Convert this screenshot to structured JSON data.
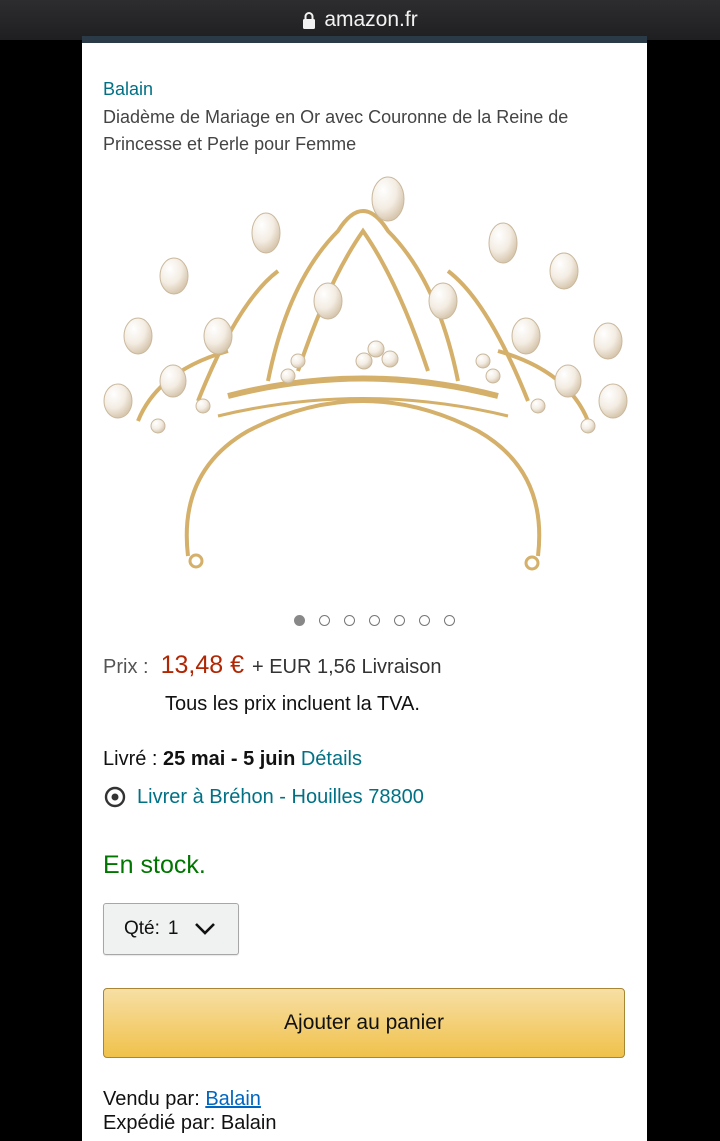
{
  "browser": {
    "url": "amazon.fr"
  },
  "product": {
    "brand": "Balain",
    "title": "Diadème de Mariage en Or avec Couronne de la Reine de Princesse et Perle pour Femme",
    "image_count": 7,
    "active_image_index": 0
  },
  "price": {
    "label": "Prix :",
    "value": "13,48 €",
    "shipping": "+ EUR 1,56 Livraison",
    "tax_note": "Tous les prix incluent la TVA."
  },
  "delivery": {
    "label": "Livré : ",
    "dates": "25 mai - 5 juin",
    "details_link": "Détails",
    "location_text": "Livrer à Bréhon - Houilles 78800"
  },
  "stock": {
    "status": "En stock."
  },
  "quantity": {
    "label": "Qté:",
    "value": "1"
  },
  "cart": {
    "button_label": "Ajouter au panier"
  },
  "seller": {
    "sold_by_label": "Vendu par:",
    "sold_by": "Balain",
    "shipped_by_label": "Expédié par:",
    "shipped_by": "Balain"
  },
  "colors": {
    "price": "#B12704",
    "link": "#007185",
    "stock": "#007600",
    "button": "#f0c14b"
  }
}
